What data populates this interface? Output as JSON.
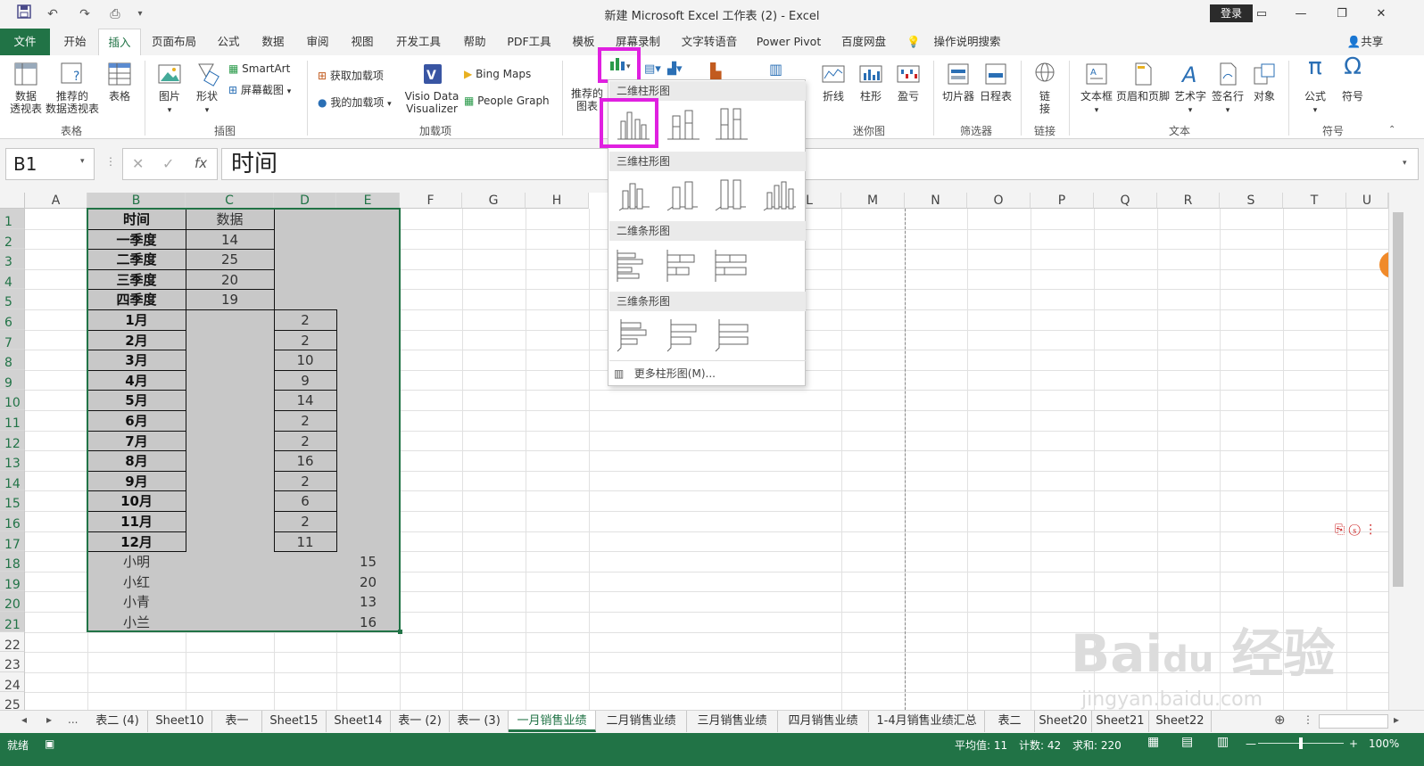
{
  "titlebar": {
    "title": "新建 Microsoft Excel 工作表 (2)  -  Excel",
    "login": "登录"
  },
  "menu": {
    "tabs": [
      "文件",
      "开始",
      "插入",
      "页面布局",
      "公式",
      "数据",
      "审阅",
      "视图",
      "开发工具",
      "帮助",
      "PDF工具",
      "模板",
      "屏幕录制",
      "文字转语音",
      "Power Pivot",
      "百度网盘"
    ],
    "search": "操作说明搜索",
    "share": "共享"
  },
  "ribbon": {
    "pivot": "数据\n透视表",
    "pivot_l1": "数据",
    "pivot_l2": "透视表",
    "rec_pivot_l1": "推荐的",
    "rec_pivot_l2": "数据透视表",
    "table": "表格",
    "group_table": "表格",
    "picture": "图片",
    "shapes": "形状",
    "smartart": "SmartArt",
    "screenshot": "屏幕截图",
    "group_illustrations": "插图",
    "get_addins": "获取加载项",
    "my_addins": "我的加载项",
    "visio_l1": "Visio Data",
    "visio_l2": "Visualizer",
    "bing_maps": "Bing Maps",
    "people_graph": "People Graph",
    "group_addins": "加载项",
    "rec_chart_l1": "推荐的",
    "rec_chart_l2": "图表",
    "line": "折线",
    "column": "柱形",
    "winloss": "盈亏",
    "group_sparklines": "迷你图",
    "slicer": "切片器",
    "timeline": "日程表",
    "group_filters": "筛选器",
    "link_l1": "链",
    "link_l2": "接",
    "group_links": "链接",
    "textbox": "文本框",
    "header_footer": "页眉和页脚",
    "wordart": "艺术字",
    "signature": "签名行",
    "object": "对象",
    "group_text": "文本",
    "equation": "公式",
    "symbol": "符号",
    "group_symbols": "符号"
  },
  "formula": {
    "namebox": "B1",
    "value": "时间"
  },
  "grid": {
    "columns": [
      "A",
      "B",
      "C",
      "D",
      "E",
      "F",
      "G",
      "H",
      "L",
      "M",
      "N",
      "O",
      "P",
      "Q",
      "R",
      "S",
      "T",
      "U"
    ],
    "rows": [
      "1",
      "2",
      "3",
      "4",
      "5",
      "6",
      "7",
      "8",
      "9",
      "10",
      "11",
      "12",
      "13",
      "14",
      "15",
      "16",
      "17",
      "18",
      "19",
      "20",
      "21",
      "22",
      "23",
      "24",
      "25"
    ],
    "B": [
      "时间",
      "一季度",
      "二季度",
      "三季度",
      "四季度",
      "1月",
      "2月",
      "3月",
      "4月",
      "5月",
      "6月",
      "7月",
      "8月",
      "9月",
      "10月",
      "11月",
      "12月",
      "小明",
      "小红",
      "小青",
      "小兰"
    ],
    "C": [
      "数据",
      "14",
      "25",
      "20",
      "19"
    ],
    "D": [
      "2",
      "2",
      "10",
      "9",
      "14",
      "2",
      "2",
      "16",
      "2",
      "6",
      "2",
      "11"
    ],
    "E": [
      "15",
      "20",
      "13",
      "16"
    ]
  },
  "dropdown": {
    "section1": "二维柱形图",
    "section2": "三维柱形图",
    "section3": "二维条形图",
    "section4": "三维条形图",
    "more": "更多柱形图(M)..."
  },
  "sheets": {
    "tabs": [
      "表二 (4)",
      "Sheet10",
      "表一",
      "Sheet15",
      "Sheet14",
      "表一 (2)",
      "表一 (3)",
      "一月销售业绩",
      "二月销售业绩",
      "三月销售业绩",
      "四月销售业绩",
      "1-4月销售业绩汇总",
      "表二",
      "Sheet20",
      "Sheet21",
      "Sheet22"
    ],
    "active": "一月销售业绩",
    "ellipsis": "..."
  },
  "status": {
    "ready": "就绪",
    "average": "平均值: 11",
    "count": "计数: 42",
    "sum": "求和: 220",
    "zoom": "100%"
  },
  "colors": {
    "excel_green": "#217346",
    "highlight": "#e020e0"
  }
}
